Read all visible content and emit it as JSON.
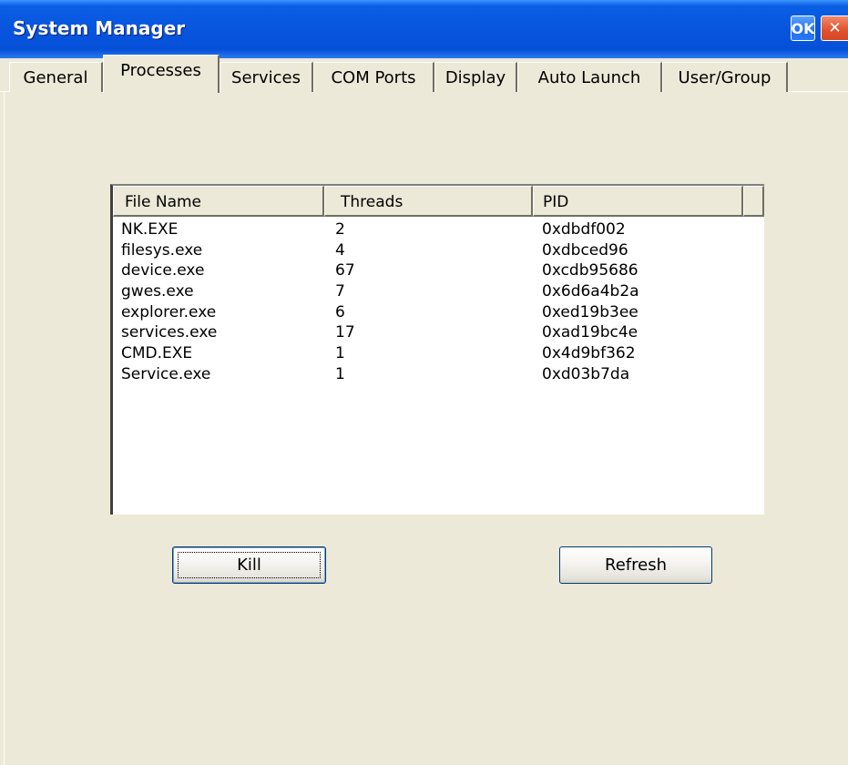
{
  "window": {
    "title": "System Manager",
    "ok_label": "OK",
    "close_label": "✕"
  },
  "tabs": [
    {
      "label": "General",
      "active": false
    },
    {
      "label": "Processes",
      "active": true
    },
    {
      "label": "Services",
      "active": false
    },
    {
      "label": "COM Ports",
      "active": false
    },
    {
      "label": "Display",
      "active": false
    },
    {
      "label": "Auto Launch",
      "active": false
    },
    {
      "label": "User/Group",
      "active": false
    }
  ],
  "process_list": {
    "columns": [
      "File Name",
      "Threads",
      "PID"
    ],
    "rows": [
      {
        "name": "NK.EXE",
        "threads": "2",
        "pid": "0xdbdf002"
      },
      {
        "name": "filesys.exe",
        "threads": "4",
        "pid": "0xdbced96"
      },
      {
        "name": "device.exe",
        "threads": "67",
        "pid": "0xcdb95686"
      },
      {
        "name": "gwes.exe",
        "threads": "7",
        "pid": "0x6d6a4b2a"
      },
      {
        "name": "explorer.exe",
        "threads": "6",
        "pid": "0xed19b3ee"
      },
      {
        "name": "services.exe",
        "threads": "17",
        "pid": "0xad19bc4e"
      },
      {
        "name": "CMD.EXE",
        "threads": "1",
        "pid": "0x4d9bf362"
      },
      {
        "name": "Service.exe",
        "threads": "1",
        "pid": "0xd03b7da"
      }
    ]
  },
  "buttons": {
    "kill_label": "Kill",
    "refresh_label": "Refresh"
  },
  "colors": {
    "titlebar": "#0855dd",
    "dialog_bg": "#ece9d8",
    "close_button": "#e0502c"
  }
}
